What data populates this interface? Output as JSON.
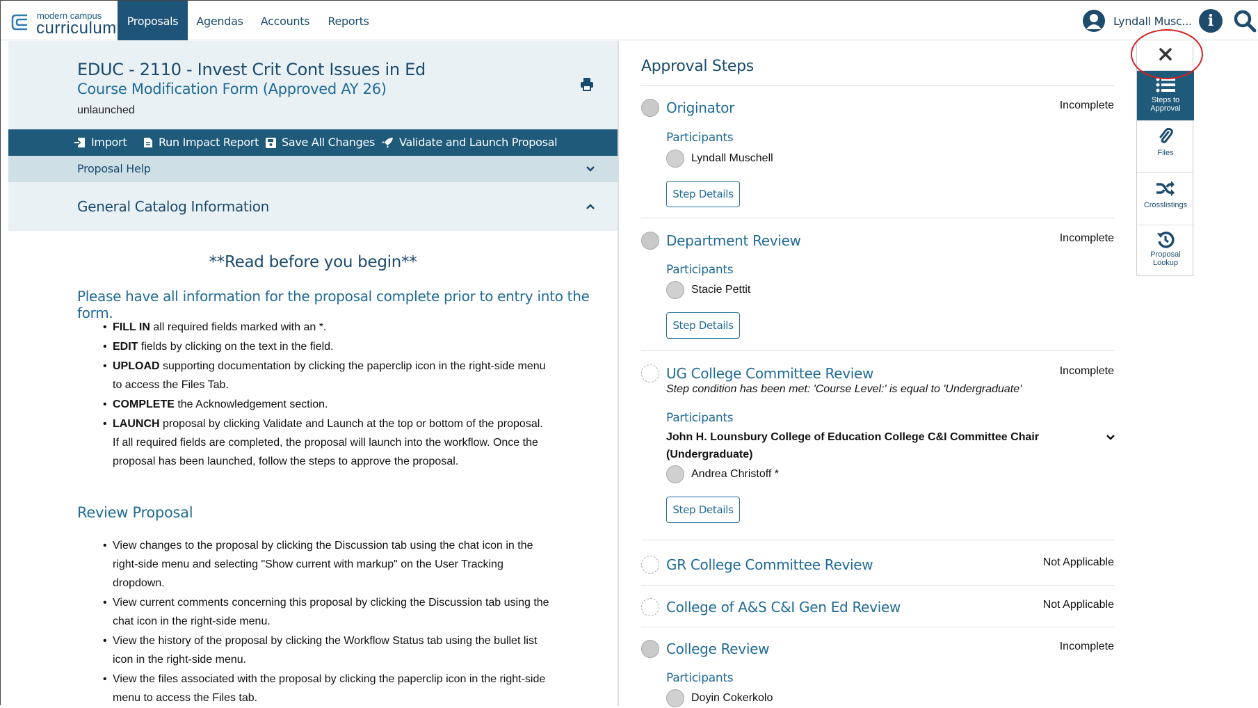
{
  "app": {
    "logo_small": "modern campus",
    "logo_big": "curriculum"
  },
  "nav": {
    "items": [
      {
        "label": "Proposals",
        "active": true
      },
      {
        "label": "Agendas"
      },
      {
        "label": "Accounts"
      },
      {
        "label": "Reports"
      }
    ],
    "user_name": "Lyndall Musc...",
    "info_icon": "info-icon",
    "search_icon": "search-icon"
  },
  "proposal": {
    "title": "EDUC - 2110 - Invest Crit Cont Issues in Ed",
    "form": "Course Modification Form (Approved AY 26)",
    "status": "unlaunched"
  },
  "toolbar": {
    "import": "Import",
    "run_impact": "Run Impact Report",
    "save_all": "Save All Changes",
    "validate_launch": "Validate and Launch Proposal"
  },
  "sections": {
    "help": "Proposal Help",
    "gci": "General Catalog Information"
  },
  "content": {
    "readme": "**Read before you begin**",
    "intro": "Please have all information for the proposal complete prior to entry into the form.",
    "instructions": [
      {
        "bold": "FILL IN",
        "rest": " all required fields marked with an *."
      },
      {
        "bold": "EDIT",
        "rest": " fields by clicking on the text in the field."
      },
      {
        "bold": "UPLOAD",
        "rest": " supporting documentation by clicking the paperclip icon in the right-side menu to access the Files Tab."
      },
      {
        "bold": "COMPLETE",
        "rest": " the Acknowledgement section."
      },
      {
        "bold": "LAUNCH",
        "rest": " proposal by clicking Validate and Launch at the top or bottom of the proposal.  If all required fields are completed, the proposal will launch into the workflow. Once the proposal has been launched, follow the steps to approve the proposal."
      }
    ],
    "review_heading": "Review Proposal",
    "review_items": [
      "View changes to the proposal by clicking the Discussion tab using the chat icon in the right-side menu and selecting \"Show current with markup\" on the User Tracking dropdown.",
      "View current comments concerning this proposal by clicking the Discussion tab using the chat icon in the right-side menu.",
      "View the history of the proposal by clicking the Workflow Status tab using the bullet list icon in the right-side menu.",
      "View the files associated with the proposal by clicking the paperclip icon in the right-side menu to access the Files tab."
    ]
  },
  "approval": {
    "heading": "Approval Steps",
    "participants_label": "Participants",
    "step_details": "Step Details",
    "steps": [
      {
        "name": "Originator",
        "status": "Incomplete",
        "participant": "Lyndall Muschell"
      },
      {
        "name": "Department Review",
        "status": "Incomplete",
        "participant": "Stacie Pettit"
      },
      {
        "name": "UG College Committee Review",
        "status": "Incomplete",
        "note": "Step condition has been met: 'Course Level:' is equal to 'Undergraduate'",
        "chair": "John H. Lounsbury College of Education College C&I Committee Chair (Undergraduate)",
        "participant": "Andrea Christoff *"
      },
      {
        "name": "GR College Committee Review",
        "status": "Not Applicable"
      },
      {
        "name": "College of A&S C&I Gen Ed Review",
        "status": "Not Applicable"
      },
      {
        "name": "College Review",
        "status": "Incomplete",
        "participant": "Doyin Cokerkolo"
      }
    ]
  },
  "sidepanel": {
    "close_icon": "close-icon",
    "items": [
      {
        "label": "Steps to Approval",
        "icon": "list-icon",
        "active": true
      },
      {
        "label": "Files",
        "icon": "paperclip-icon"
      },
      {
        "label": "Crosslistings",
        "icon": "shuffle-icon"
      },
      {
        "label": "Proposal Lookup",
        "icon": "history-icon"
      }
    ]
  },
  "colors": {
    "primary": "#1e5478",
    "link": "#1f6a96",
    "header_bg": "#e9f1f4",
    "annotation": "#d62020"
  }
}
